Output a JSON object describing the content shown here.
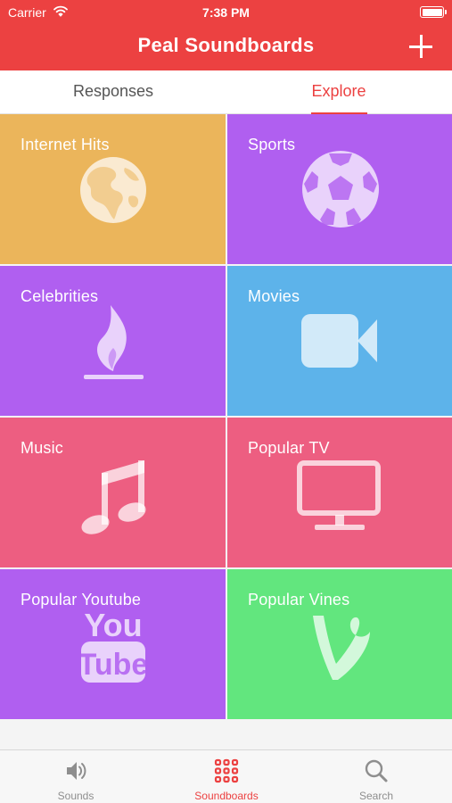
{
  "status_bar": {
    "carrier": "Carrier",
    "time": "7:38 PM"
  },
  "header": {
    "title": "Peal Soundboards",
    "add_icon": "plus-icon"
  },
  "segments": {
    "responses": "Responses",
    "explore": "Explore",
    "selected": "Explore"
  },
  "tiles": [
    {
      "label": "Internet Hits",
      "icon": "globe-icon",
      "color": "#ebb55b"
    },
    {
      "label": "Sports",
      "icon": "soccer-ball-icon",
      "color": "#b05ff0"
    },
    {
      "label": "Celebrities",
      "icon": "flame-icon",
      "color": "#b05ff0"
    },
    {
      "label": "Movies",
      "icon": "video-camera-icon",
      "color": "#5db3ea"
    },
    {
      "label": "Music",
      "icon": "music-note-icon",
      "color": "#ed5e81"
    },
    {
      "label": "Popular TV",
      "icon": "tv-icon",
      "color": "#ed5e81"
    },
    {
      "label": "Popular Youtube",
      "icon": "youtube-icon",
      "color": "#b05ff0"
    },
    {
      "label": "Popular Vines",
      "icon": "vine-icon",
      "color": "#62e67e"
    }
  ],
  "youtube_logo": {
    "line1": "You",
    "line2": "Tube"
  },
  "tab_bar": {
    "items": [
      {
        "label": "Sounds",
        "icon": "speaker-icon"
      },
      {
        "label": "Soundboards",
        "icon": "grid-icon"
      },
      {
        "label": "Search",
        "icon": "search-icon"
      }
    ],
    "selected": "Soundboards"
  },
  "colors": {
    "accent": "#ec4141",
    "inactive": "#8e8e8e"
  }
}
